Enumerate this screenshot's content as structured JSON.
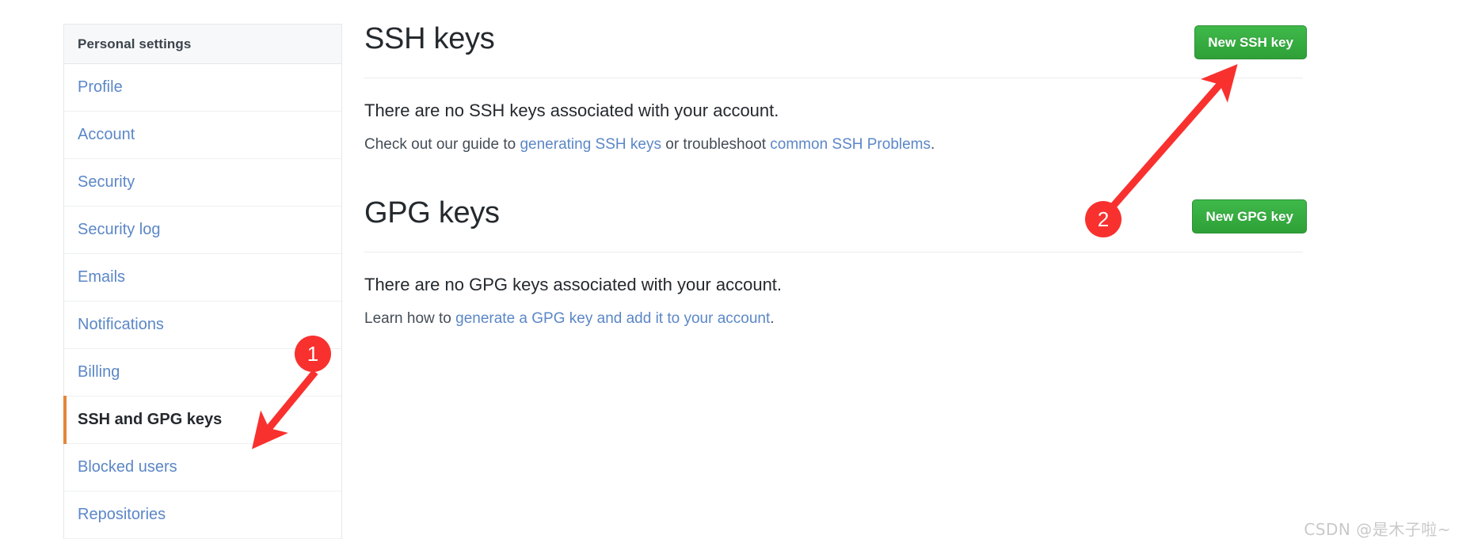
{
  "sidebar": {
    "header": "Personal settings",
    "items": [
      {
        "label": "Profile",
        "active": false
      },
      {
        "label": "Account",
        "active": false
      },
      {
        "label": "Security",
        "active": false
      },
      {
        "label": "Security log",
        "active": false
      },
      {
        "label": "Emails",
        "active": false
      },
      {
        "label": "Notifications",
        "active": false
      },
      {
        "label": "Billing",
        "active": false
      },
      {
        "label": "SSH and GPG keys",
        "active": true
      },
      {
        "label": "Blocked users",
        "active": false
      },
      {
        "label": "Repositories",
        "active": false
      }
    ]
  },
  "main": {
    "ssh": {
      "title": "SSH keys",
      "button": "New SSH key",
      "empty_text": "There are no SSH keys associated with your account.",
      "help_prefix": "Check out our guide to ",
      "help_link1": "generating SSH keys",
      "help_middle": " or troubleshoot ",
      "help_link2": "common SSH Problems",
      "help_suffix": "."
    },
    "gpg": {
      "title": "GPG keys",
      "button": "New GPG key",
      "empty_text": "There are no GPG keys associated with your account.",
      "help_prefix": "Learn how to ",
      "help_link1": "generate a GPG key and add it to your account",
      "help_suffix": "."
    }
  },
  "annotations": {
    "marker1": "1",
    "marker2": "2",
    "color": "#f8312f"
  },
  "watermark": "CSDN @是木子啦~"
}
